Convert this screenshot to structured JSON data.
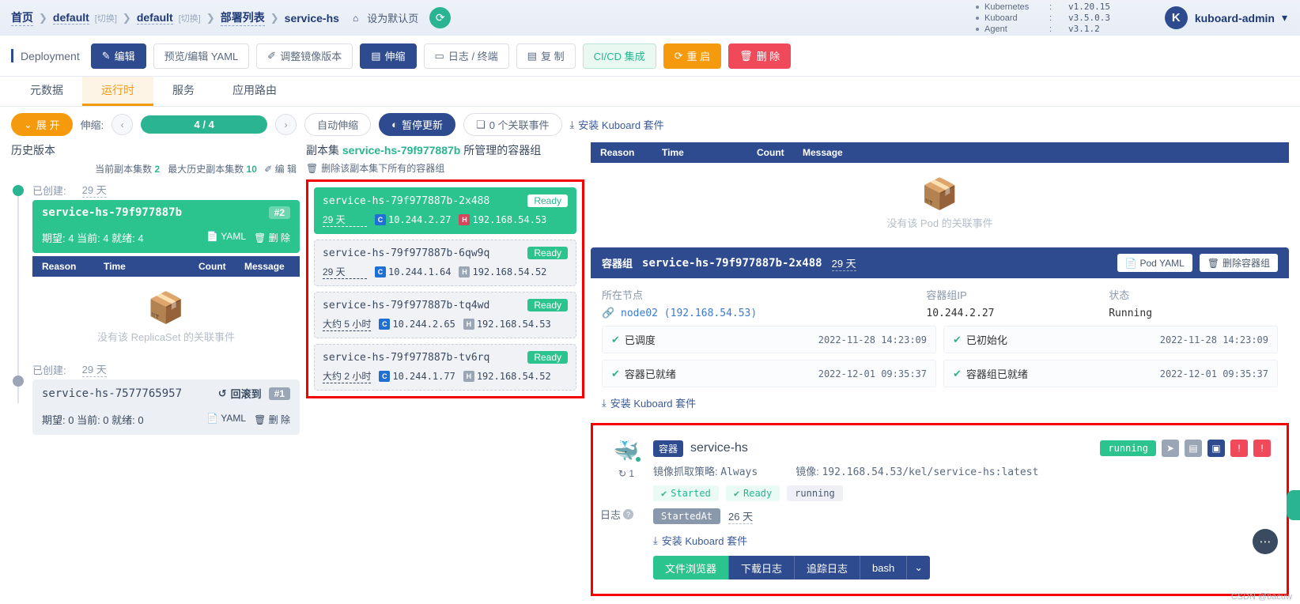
{
  "header": {
    "breadcrumbs": [
      {
        "label": "首页",
        "type": "link"
      },
      {
        "label": "default",
        "type": "link",
        "switch": "[切换]"
      },
      {
        "label": "default",
        "type": "link",
        "switch": "[切换]"
      },
      {
        "label": "部署列表",
        "type": "link"
      },
      {
        "label": "service-hs",
        "type": "plain"
      }
    ],
    "set_default_page": "设为默认页",
    "refresh_icon": "refresh-icon",
    "cluster": [
      {
        "key": "Kubernetes",
        "value": "v1.20.15"
      },
      {
        "key": "Kuboard",
        "value": "v3.5.0.3"
      },
      {
        "key": "Agent",
        "value": "v3.1.2"
      }
    ],
    "user": {
      "initial": "K",
      "name": "kuboard-admin"
    }
  },
  "toolbar": {
    "kind": "Deployment",
    "buttons": [
      {
        "label": "编辑",
        "style": "primary",
        "icon": "edit-icon"
      },
      {
        "label": "预览/编辑 YAML",
        "style": "plain",
        "icon": ""
      },
      {
        "label": "调整镜像版本",
        "style": "plain",
        "icon": "pencil-icon"
      },
      {
        "label": "伸缩",
        "style": "primary",
        "icon": "scale-icon"
      },
      {
        "label": "日志 / 终端",
        "style": "plain",
        "icon": "terminal-icon"
      },
      {
        "label": "复 制",
        "style": "plain",
        "icon": "copy-icon"
      },
      {
        "label": "CI/CD 集成",
        "style": "cicd",
        "icon": ""
      },
      {
        "label": "重 启",
        "style": "restart",
        "icon": "restart-icon"
      },
      {
        "label": "删 除",
        "style": "delete",
        "icon": "trash-icon"
      }
    ]
  },
  "tabs": [
    {
      "label": "元数据",
      "active": false
    },
    {
      "label": "运行时",
      "active": true
    },
    {
      "label": "服务",
      "active": false
    },
    {
      "label": "应用路由",
      "active": false
    }
  ],
  "controls": {
    "expand": "展 开",
    "scale_label": "伸缩:",
    "scale_value": "4 / 4",
    "prev_icon": "chevron-left-icon",
    "next_icon": "chevron-right-icon",
    "autoscale": "自动伸缩",
    "pause": "暂停更新",
    "events": "0 个关联事件",
    "install": "安装 Kuboard 套件"
  },
  "history": {
    "title": "历史版本",
    "current_rs_label": "当前副本集数",
    "current_rs_value": "2",
    "max_rs_label": "最大历史副本集数",
    "max_rs_value": "10",
    "edit": "编 辑",
    "items": [
      {
        "created_label": "已创建:",
        "age": "29 天",
        "name": "service-hs-79f977887b",
        "badge": "#2",
        "stats": "期望: 4 当前: 4 就绪: 4",
        "yaml": "YAML",
        "delete": "删 除",
        "active": true
      },
      {
        "created_label": "已创建:",
        "age": "29 天",
        "name": "service-hs-7577765957",
        "badge": "#1",
        "stats": "期望: 0 当前: 0 就绪: 0",
        "rollback": "回滚到",
        "yaml": "YAML",
        "delete": "删 除",
        "active": false
      }
    ],
    "events": {
      "columns": [
        "Reason",
        "Time",
        "Count",
        "Message"
      ],
      "empty": "没有该 ReplicaSet 的关联事件"
    }
  },
  "pods": {
    "title_prefix": "副本集",
    "title_rs": "service-hs-79f977887b",
    "title_suffix": "所管理的容器组",
    "delete_all": "删除该副本集下所有的容器组",
    "list": [
      {
        "name": "service-hs-79f977887b-2x488",
        "status": "Ready",
        "age": "29 天",
        "pod_ip": "10.244.2.27",
        "host_ip": "192.168.54.53",
        "selected": true
      },
      {
        "name": "service-hs-79f977887b-6qw9q",
        "status": "Ready",
        "age": "29 天",
        "pod_ip": "10.244.1.64",
        "host_ip": "192.168.54.52",
        "selected": false
      },
      {
        "name": "service-hs-79f977887b-tq4wd",
        "status": "Ready",
        "age": "大约 5 小时",
        "pod_ip": "10.244.2.65",
        "host_ip": "192.168.54.53",
        "selected": false
      },
      {
        "name": "service-hs-79f977887b-tv6rq",
        "status": "Ready",
        "age": "大约 2 小时",
        "pod_ip": "10.244.1.77",
        "host_ip": "192.168.54.52",
        "selected": false
      }
    ]
  },
  "pod_events": {
    "columns": [
      "Reason",
      "Time",
      "Count",
      "Message"
    ],
    "empty": "没有该 Pod 的关联事件"
  },
  "pod_detail": {
    "tag": "容器组",
    "name": "service-hs-79f977887b-2x488",
    "age": "29 天",
    "yaml_btn": "Pod YAML",
    "delete_btn": "删除容器组",
    "node_label": "所在节点",
    "node_value": "node02  (192.168.54.53)",
    "ip_label": "容器组IP",
    "ip_value": "10.244.2.27",
    "status_label": "状态",
    "status_value": "Running",
    "conditions": [
      {
        "label": "已调度",
        "time": "2022-11-28 14:23:09"
      },
      {
        "label": "已初始化",
        "time": "2022-11-28 14:23:09"
      },
      {
        "label": "容器已就绪",
        "time": "2022-12-01 09:35:37"
      },
      {
        "label": "容器组已就绪",
        "time": "2022-12-01 09:35:37"
      }
    ],
    "install": "安装 Kuboard 套件"
  },
  "container": {
    "tag": "容器",
    "name": "service-hs",
    "restart_count": "1",
    "pull_policy_label": "镜像抓取策略:",
    "pull_policy": "Always",
    "image_label": "镜像:",
    "image": "192.168.54.53/kel/service-hs:latest",
    "state_badge": "running",
    "chips": [
      {
        "label": "Started",
        "type": "ok"
      },
      {
        "label": "Ready",
        "type": "ok"
      },
      {
        "label": "running",
        "type": "run"
      }
    ],
    "started_at_label": "StartedAt",
    "started_at_value": "26 天",
    "log_label": "日志",
    "install": "安装 Kuboard 套件",
    "actions": [
      {
        "label": "文件浏览器",
        "style": "green"
      },
      {
        "label": "下载日志",
        "style": "blue"
      },
      {
        "label": "追踪日志",
        "style": "blue"
      },
      {
        "label": "bash",
        "style": "blue"
      }
    ],
    "icons": [
      "send-icon",
      "lock-icon",
      "database-icon",
      "info-icon",
      "info-icon"
    ]
  },
  "watermark": "CSDN @bacuw",
  "colors": {
    "primary": "#2f4b8f",
    "green": "#2bc48e",
    "orange": "#f59a0c",
    "red": "#f04a5a",
    "highlight_box": "#f50000"
  }
}
